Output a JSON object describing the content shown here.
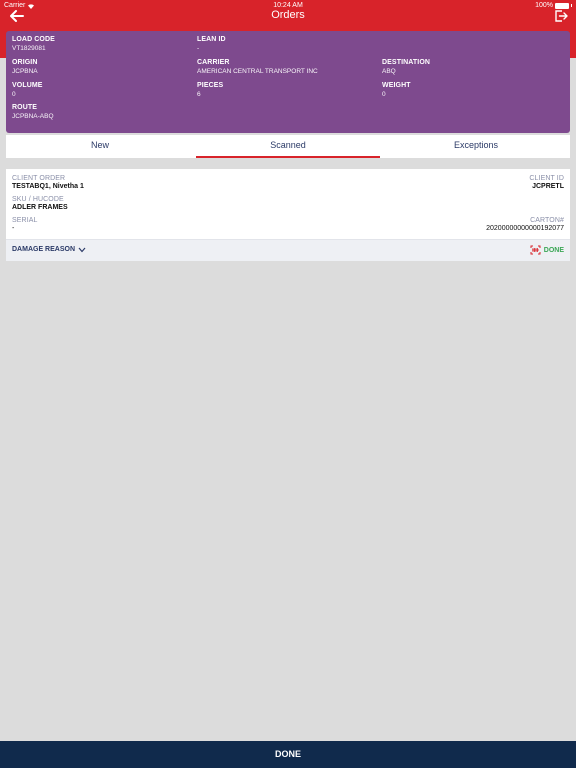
{
  "status_bar": {
    "carrier": "Carrier",
    "time": "10:24 AM",
    "battery": "100%"
  },
  "header": {
    "title": "Orders",
    "back_icon": "arrow-left-icon",
    "logout_icon": "logout-icon",
    "color": "#d8232a"
  },
  "load_info": {
    "color": "#7e4a8e",
    "load_code": {
      "label": "LOAD CODE",
      "value": "VT1829081"
    },
    "lean_id": {
      "label": "LEAN ID",
      "value": "-"
    },
    "origin": {
      "label": "ORIGIN",
      "value": "JCPBNA"
    },
    "carrier": {
      "label": "CARRIER",
      "value": "AMERICAN CENTRAL TRANSPORT INC"
    },
    "destination": {
      "label": "DESTINATION",
      "value": "ABQ"
    },
    "volume": {
      "label": "VOLUME",
      "value": "0"
    },
    "pieces": {
      "label": "PIECES",
      "value": "6"
    },
    "weight": {
      "label": "WEIGHT",
      "value": "0"
    },
    "route": {
      "label": "ROUTE",
      "value": "JCPBNA-ABQ"
    }
  },
  "tabs": [
    {
      "label": "New",
      "active": false
    },
    {
      "label": "Scanned",
      "active": true
    },
    {
      "label": "Exceptions",
      "active": false
    }
  ],
  "order": {
    "client_order": {
      "label": "CLIENT ORDER",
      "value": "TESTABQ1, Nivetha 1"
    },
    "client_id": {
      "label": "CLIENT ID",
      "value": "JCPRETL"
    },
    "sku": {
      "label": "SKU / HUCODE",
      "value": "ADLER FRAMES"
    },
    "serial": {
      "label": "SERIAL",
      "value": "-"
    },
    "carton": {
      "label": "CARTON#",
      "value": "20200000000000192077"
    },
    "damage_reason_label": "DAMAGE REASON",
    "done_label": "DONE",
    "done_color": "#3aa655"
  },
  "footer": {
    "done_label": "DONE",
    "color": "#102a4c"
  }
}
